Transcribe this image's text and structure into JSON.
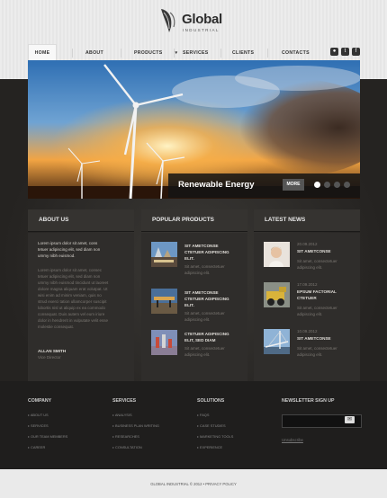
{
  "logo": {
    "title": "Global",
    "subtitle": "INDUSTRIAL"
  },
  "nav": {
    "items": [
      {
        "label": "HOME"
      },
      {
        "label": "ABOUT"
      },
      {
        "label": "PRODUCTS"
      },
      {
        "label": "SERVICES"
      },
      {
        "label": "CLIENTS"
      },
      {
        "label": "CONTACTS"
      }
    ]
  },
  "social": [
    "dribbble-icon",
    "twitter-icon",
    "facebook-icon"
  ],
  "slider": {
    "caption": "Renewable Energy",
    "more": "MORE",
    "active_slide": 1,
    "slide_count": 4
  },
  "about": {
    "title": "ABOUT US",
    "lead": [
      "Lorem ipsum dolor sit amet, cons",
      "tetuer adipiscing elit, sed diam non",
      "ummy nibh euismod."
    ],
    "body": [
      "Lorem ipsum dolor sit amet, consec",
      "tetuer adipiscing elit, sed diam non",
      "ummy nibh euismod tincidunt ut laoreet",
      "dolore magna aliquam erat volutpat. Ut",
      "wisi enim ad minim veniam, quis no",
      "strud exerci tation ullamcorper suscipit",
      "lobortis nisl ut aliquip ex ea commodo",
      "consequat. Duis autem vel eum iriure",
      "dolor in hendrerit in vulputate velit esse",
      "molestie consequat."
    ],
    "author": "ALLAN SMITH",
    "role": "Vice Director"
  },
  "products": {
    "title": "POPULAR PRODUCTS",
    "items": [
      {
        "title": [
          "SIT AMETCONSE",
          "CTETUER ADIPISCING",
          "ELIT."
        ],
        "text": [
          "Sit amet, consectetuer",
          "adipiscing elit."
        ]
      },
      {
        "title": [
          "SIT AMETCONSE",
          "CTETUER ADIPISCING",
          "ELIT."
        ],
        "text": [
          "Sit amet, consectetuer",
          "adipiscing elit."
        ]
      },
      {
        "title": [
          "CTETUER ADIPISCING",
          "ELIT, SED DIAM"
        ],
        "text": [
          "Sit amet, consectetuer",
          "adipiscing elit."
        ]
      }
    ]
  },
  "news": {
    "title": "LATEST NEWS",
    "items": [
      {
        "date": "20.09.2012",
        "title": [
          "SIT AMETCONSE"
        ],
        "text": [
          "Sit amet, consectetuer",
          "adipiscing elit."
        ]
      },
      {
        "date": "17.09.2012",
        "title": [
          "EPSUM FACTORIAL",
          "CTETUER"
        ],
        "text": [
          "Sit amet, consectetuer",
          "adipiscing elit."
        ]
      },
      {
        "date": "10.09.2012",
        "title": [
          "SIT AMETCONSE"
        ],
        "text": [
          "Sit amet, consectetuer",
          "adipiscing elit."
        ]
      }
    ]
  },
  "footer": {
    "company": {
      "title": "COMPANY",
      "links": [
        "ABOUT US",
        "SERVICES",
        "OUR TEAM MEMBERS",
        "CAREER"
      ]
    },
    "services": {
      "title": "SERVICES",
      "links": [
        "ANALYSIS",
        "BUSINESS PLAN WRITING",
        "RESEARCHES",
        "CONSULTATION"
      ]
    },
    "solutions": {
      "title": "SOLUTIONS",
      "links": [
        "FAQS",
        "CASE STUDIES",
        "MARKETING TOOLS",
        "EXPERIENCE"
      ]
    },
    "newsletter": {
      "title": "NEWSLETTER SIGN UP",
      "placeholder": "",
      "unsubscribe": "Unsubscribe"
    },
    "copyright": "GLOBAL INDUSTRIAL © 2012 • PRIVACY POLICY"
  },
  "colors": {
    "accent": "#2b2927",
    "caption_bg": "#141414"
  }
}
